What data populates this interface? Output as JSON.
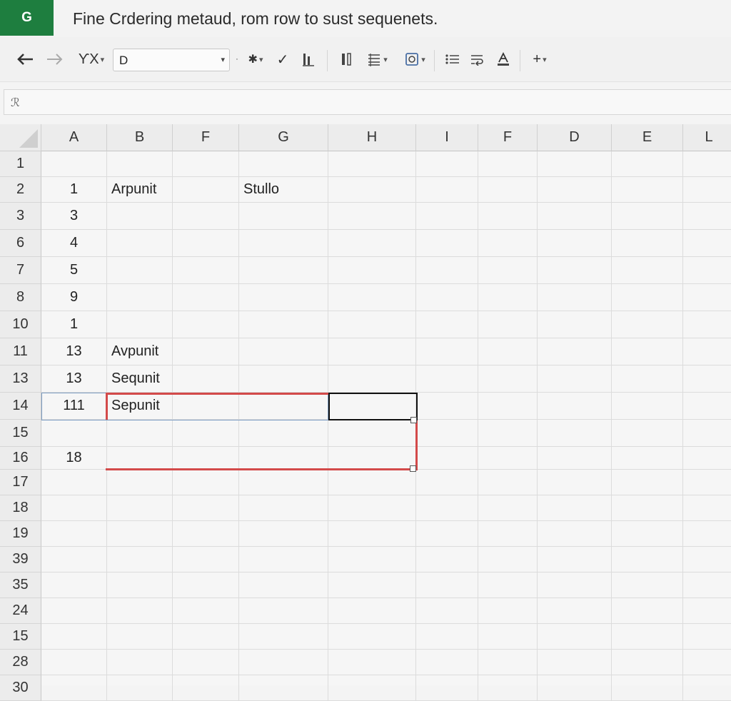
{
  "app": {
    "badge": "G",
    "title": "Fine   Crdering metaud, rom row to sust sequenets."
  },
  "toolbar": {
    "undo_icon": "undo-arrow-icon",
    "redo_icon": "redo-arrow-icon",
    "fx_label": "ƳX",
    "font_value": "D",
    "check_glyph": "✓",
    "add_label": "+"
  },
  "formula_bar": {
    "placeholder": "ℛ"
  },
  "columns": [
    "A",
    "B",
    "F",
    "G",
    "H",
    "I",
    "F",
    "D",
    "E",
    "L"
  ],
  "rows": [
    {
      "num": "1",
      "a": "",
      "b": "",
      "g": ""
    },
    {
      "num": "2",
      "a": "1",
      "b": "Arpunit",
      "g": "Stullo"
    },
    {
      "num": "3",
      "a": "3",
      "b": "",
      "g": ""
    },
    {
      "num": "6",
      "a": "4",
      "b": "",
      "g": ""
    },
    {
      "num": "7",
      "a": "5",
      "b": "",
      "g": ""
    },
    {
      "num": "8",
      "a": "9",
      "b": "",
      "g": ""
    },
    {
      "num": "10",
      "a": "1",
      "b": "",
      "g": ""
    },
    {
      "num": "11",
      "a": "13",
      "b": "Avpunit",
      "g": ""
    },
    {
      "num": "13",
      "a": "13",
      "b": "Sequnit",
      "g": ""
    },
    {
      "num": "14",
      "a": "111",
      "b": "Sepunit",
      "g": ""
    },
    {
      "num": "15",
      "a": "",
      "b": "",
      "g": ""
    },
    {
      "num": "16",
      "a": "18",
      "b": "",
      "g": ""
    },
    {
      "num": "17",
      "a": "",
      "b": "",
      "g": ""
    },
    {
      "num": "18",
      "a": "",
      "b": "",
      "g": ""
    },
    {
      "num": "19",
      "a": "",
      "b": "",
      "g": ""
    },
    {
      "num": "39",
      "a": "",
      "b": "",
      "g": ""
    },
    {
      "num": "35",
      "a": "",
      "b": "",
      "g": ""
    },
    {
      "num": "24",
      "a": "",
      "b": "",
      "g": ""
    },
    {
      "num": "15",
      "a": "",
      "b": "",
      "g": ""
    },
    {
      "num": "28",
      "a": "",
      "b": "",
      "g": ""
    },
    {
      "num": "30",
      "a": "",
      "b": "",
      "g": ""
    }
  ],
  "colors": {
    "brand": "#1e7e3f",
    "selection_red": "#d34a4a",
    "active_cell": "#111111"
  }
}
